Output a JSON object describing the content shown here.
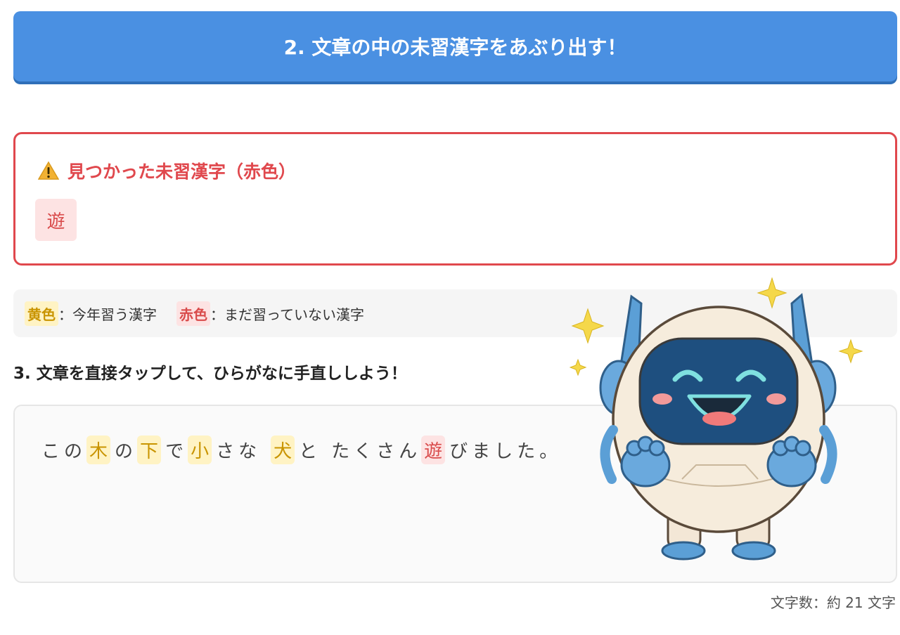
{
  "step2": {
    "button_label": "2. 文章の中の未習漢字をあぶり出す！"
  },
  "found": {
    "title": "見つかった未習漢字（赤色）",
    "kanji": [
      "遊"
    ]
  },
  "legend": {
    "yellow_label": "黄色",
    "yellow_desc": "：今年習う漢字",
    "red_label": "赤色",
    "red_desc": "：まだ習っていない漢字"
  },
  "step3": {
    "heading": "3. 文章を直接タップして、ひらがなに手直ししよう！"
  },
  "sentence": [
    {
      "text": "この",
      "type": "plain"
    },
    {
      "text": "木",
      "type": "yellow"
    },
    {
      "text": "の",
      "type": "plain"
    },
    {
      "text": "下",
      "type": "yellow"
    },
    {
      "text": "で",
      "type": "plain"
    },
    {
      "text": "小",
      "type": "yellow"
    },
    {
      "text": "さな",
      "type": "plain"
    },
    {
      "text": "犬",
      "type": "yellow"
    },
    {
      "text": "と",
      "type": "plain"
    },
    {
      "text": "たくさん",
      "type": "plain"
    },
    {
      "text": "遊",
      "type": "red"
    },
    {
      "text": "びました。",
      "type": "plain"
    }
  ],
  "char_count": "文字数：約 21 文字",
  "colors": {
    "accent": "#4a90e2",
    "warning": "#e0484d",
    "yellow": "#c99400",
    "red": "#d94b4b"
  }
}
